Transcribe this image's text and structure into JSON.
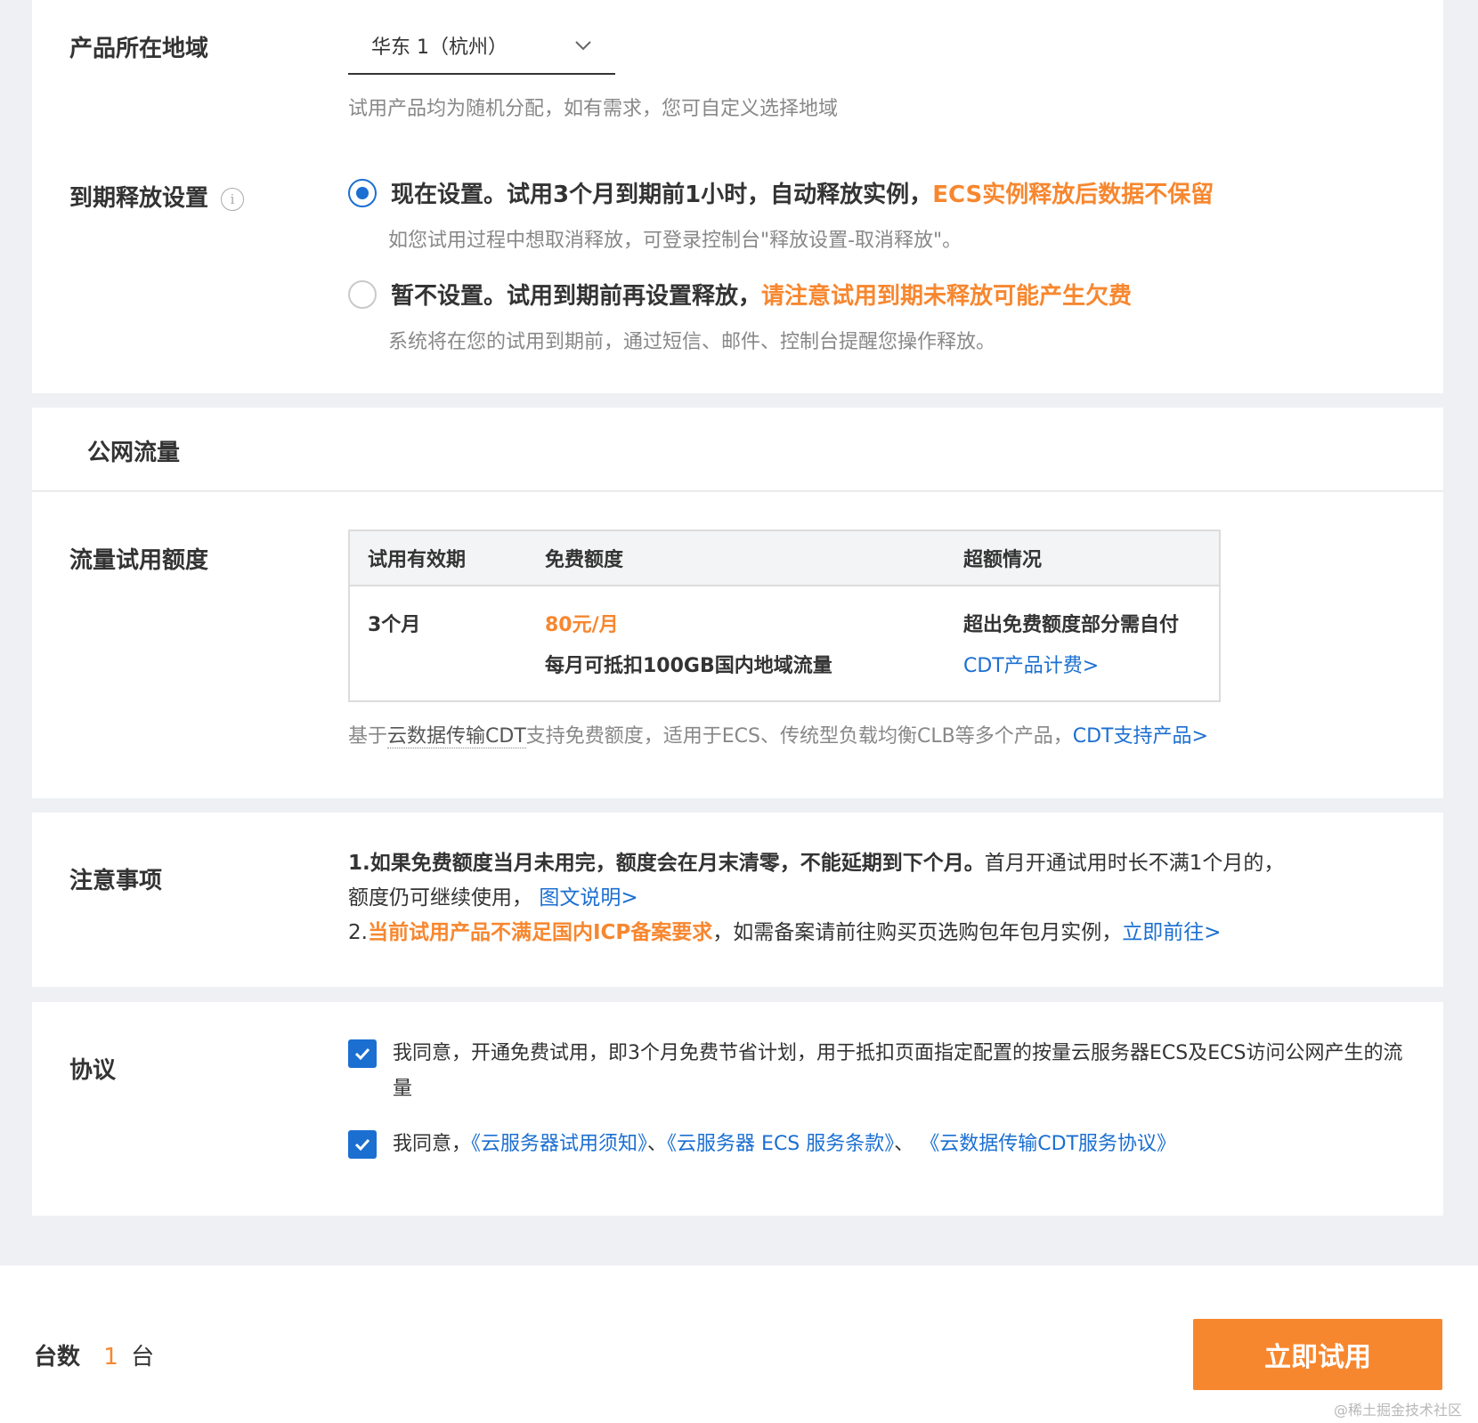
{
  "region": {
    "label": "产品所在地域",
    "value": "华东 1（杭州）",
    "hint": "试用产品均为随机分配，如有需求，您可自定义选择地域"
  },
  "release": {
    "label": "到期释放设置",
    "info_icon": "i",
    "option1": {
      "text": "现在设置。试用3个月到期前1小时，自动释放实例，",
      "warn": "ECS实例释放后数据不保留",
      "hint": "如您试用过程中想取消释放，可登录控制台\"释放设置-取消释放\"。",
      "selected": true
    },
    "option2": {
      "text": "暂不设置。试用到期前再设置释放，",
      "warn": "请注意试用到期未释放可能产生欠费",
      "hint": "系统将在您的试用到期前，通过短信、邮件、控制台提醒您操作释放。",
      "selected": false
    }
  },
  "traffic": {
    "section_title": "公网流量",
    "label": "流量试用额度",
    "table": {
      "headers": [
        "试用有效期",
        "免费额度",
        "超额情况"
      ],
      "row": {
        "period": "3个月",
        "quota_price": "80元/月",
        "quota_desc": "每月可抵扣100GB国内地域流量",
        "overage": "超出免费额度部分需自付",
        "overage_link": "CDT产品计费>"
      }
    },
    "note_prefix": "基于",
    "note_term": "云数据传输CDT",
    "note_suffix": "支持免费额度，适用于ECS、传统型负载均衡CLB等多个产品，",
    "note_link": "CDT支持产品>"
  },
  "notice": {
    "label": "注意事项",
    "line1_bold": "1.如果免费额度当月未用完，额度会在月末清零，不能延期到下个月。",
    "line1_rest": "首月开通试用时长不满1个月的，",
    "line2_text": "额度仍可继续使用，",
    "line2_link": "图文说明>",
    "line3_prefix": "2.",
    "line3_warn": "当前试用产品不满足国内ICP备案要求",
    "line3_text": "，如需备案请前往购买页选购包年包月实例，",
    "line3_link": "立即前往>"
  },
  "agreement": {
    "label": "协议",
    "item1": "我同意，开通免费试用，即3个月免费节省计划，用于抵扣页面指定配置的按量云服务器ECS及ECS访问公网产生的流量",
    "item2_prefix": "我同意，",
    "item2_link1": "《云服务器试用须知》",
    "item2_sep1": "、",
    "item2_link2": "《云服务器 ECS 服务条款》",
    "item2_sep2": "、",
    "item2_link3": "《云数据传输CDT服务协议》"
  },
  "footer": {
    "count_label": "台数",
    "count_value": "1",
    "count_unit": "台",
    "button": "立即试用",
    "watermark": "@稀土掘金技术社区"
  },
  "colors": {
    "accent_orange": "#f7872f",
    "link_blue": "#1b6fd1"
  }
}
